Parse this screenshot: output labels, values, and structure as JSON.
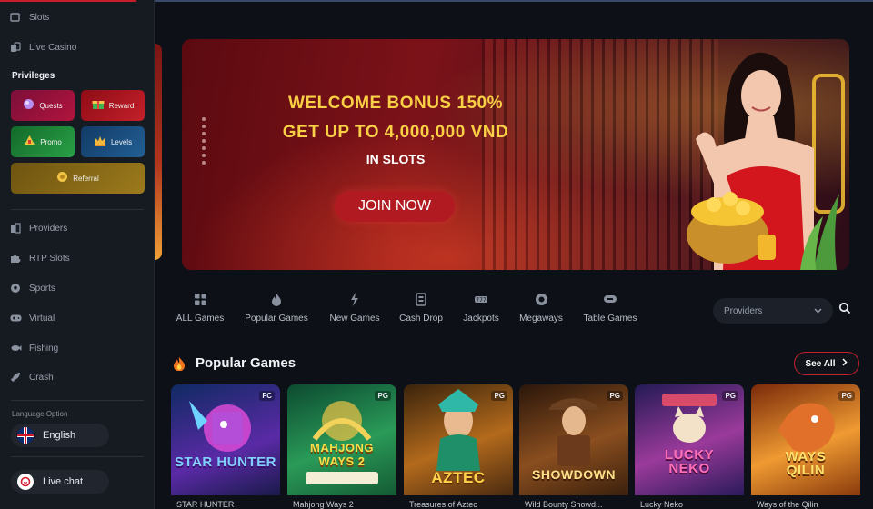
{
  "sidebar": {
    "top_items": [
      {
        "label": "Slots",
        "icon": "slot-machine-icon"
      },
      {
        "label": "Live Casino",
        "icon": "cards-icon"
      }
    ],
    "privileges_heading": "Privileges",
    "privileges": [
      {
        "label": "Quests",
        "icon": "quest-icon",
        "color": "#8a1030"
      },
      {
        "label": "Reward",
        "icon": "reward-icon",
        "color": "#a0101c"
      },
      {
        "label": "Promo",
        "icon": "promo-icon",
        "color": "#1d7a2e"
      },
      {
        "label": "Levels",
        "icon": "crown-icon",
        "color": "#1d4b78"
      },
      {
        "label": "Referral",
        "icon": "referral-icon",
        "color": "#8a6a14"
      }
    ],
    "nav_items": [
      {
        "label": "Providers",
        "icon": "building-icon"
      },
      {
        "label": "RTP Slots",
        "icon": "puzzle-icon"
      },
      {
        "label": "Sports",
        "icon": "soccer-ball-icon"
      },
      {
        "label": "Virtual",
        "icon": "gamepad-icon"
      },
      {
        "label": "Fishing",
        "icon": "fish-icon"
      },
      {
        "label": "Crash",
        "icon": "rocket-icon"
      }
    ],
    "language_label": "Language Option",
    "language_value": "English",
    "live_chat_label": "Live chat"
  },
  "banner": {
    "line1": "WELCOME BONUS 150%",
    "line2": "GET UP TO 4,000,000 VND",
    "line3": "IN SLOTS",
    "cta": "JOIN NOW"
  },
  "categories": [
    {
      "label": "ALL Games",
      "icon": "grid-icon"
    },
    {
      "label": "Popular Games",
      "icon": "flame-icon"
    },
    {
      "label": "New Games",
      "icon": "lightning-icon"
    },
    {
      "label": "Cash Drop",
      "icon": "cash-drop-icon"
    },
    {
      "label": "Jackpots",
      "icon": "jackpot-icon"
    },
    {
      "label": "Megaways",
      "icon": "megaways-icon"
    },
    {
      "label": "Table Games",
      "icon": "table-games-icon"
    }
  ],
  "providers_select": {
    "value": "Providers"
  },
  "section": {
    "title": "Popular Games",
    "see_all": "See All"
  },
  "games": [
    {
      "name": "STAR HUNTER",
      "logo": "STAR HUNTER",
      "provider_badge": "FC",
      "colors": [
        "#17326e",
        "#6a2fb0"
      ],
      "logo_color": "#7fd0ff"
    },
    {
      "name": "Mahjong Ways 2",
      "logo": "MAHJONG WAYS 2",
      "provider_badge": "PG",
      "colors": [
        "#0f5e3a",
        "#2ea25c"
      ],
      "logo_color": "#f5e04a"
    },
    {
      "name": "Treasures of Aztec",
      "logo": "AZTEC",
      "provider_badge": "PG",
      "colors": [
        "#4a2a0c",
        "#c26a18"
      ],
      "logo_color": "#ffd24a"
    },
    {
      "name": "Wild Bounty Showd...",
      "logo": "SHOWDOWN",
      "provider_badge": "PG",
      "colors": [
        "#3a1e0d",
        "#9b5a24"
      ],
      "logo_color": "#ffe08a"
    },
    {
      "name": "Lucky Neko",
      "logo": "LUCKY NEKO",
      "provider_badge": "PG",
      "colors": [
        "#2a1d5e",
        "#b23aa0"
      ],
      "logo_color": "#ff6fb8"
    },
    {
      "name": "Ways of the Qilin",
      "logo": "WAYS QILIN",
      "provider_badge": "PG",
      "colors": [
        "#8a3a0c",
        "#f0a23a"
      ],
      "logo_color": "#ffe06a"
    }
  ]
}
